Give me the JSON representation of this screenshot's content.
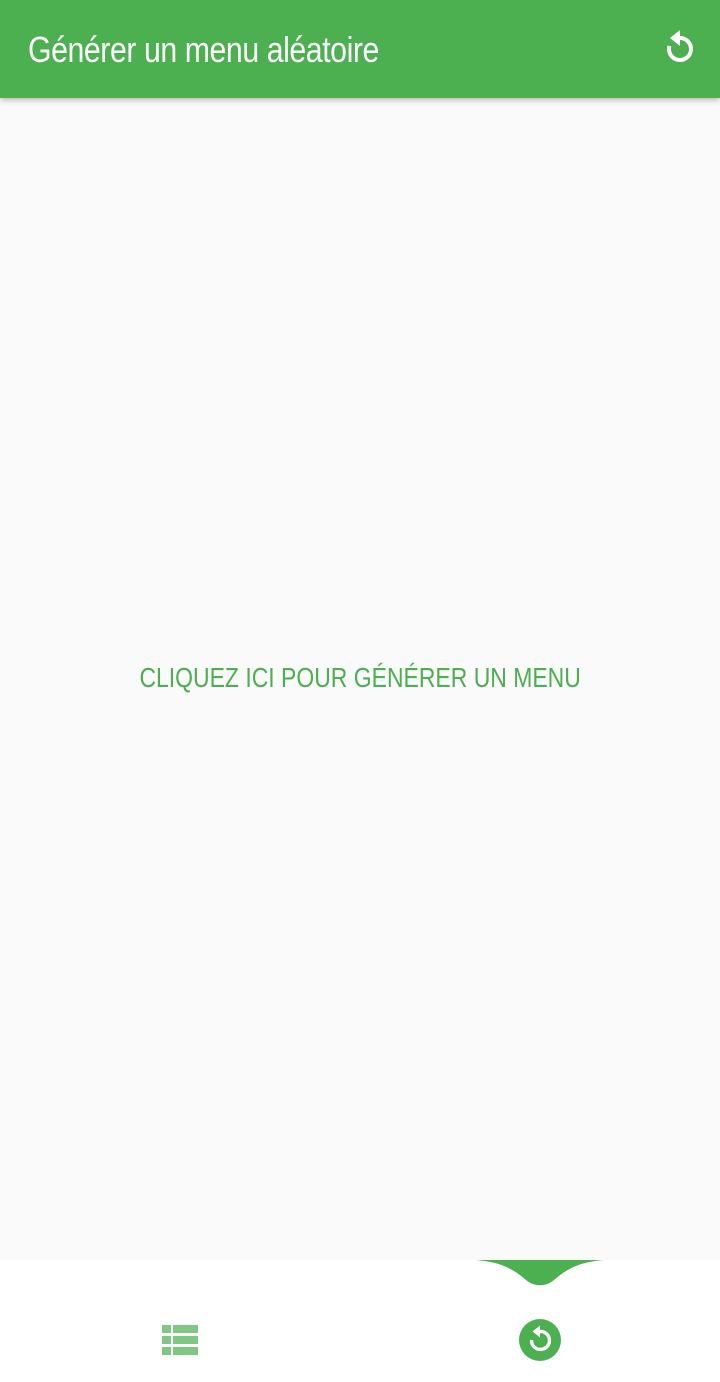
{
  "appbar": {
    "title": "Générer un menu aléatoire",
    "action_icon": "refresh-icon"
  },
  "content": {
    "generate_label": "CLIQUEZ ICI POUR GÉNÉRER UN MENU"
  },
  "bottom_nav": {
    "items": [
      {
        "icon": "list-icon",
        "active": false
      },
      {
        "icon": "refresh-circle-icon",
        "active": true
      }
    ]
  },
  "colors": {
    "primary": "#4caf50",
    "primary_light": "#81c784",
    "background": "#fafafa",
    "nav_background": "#ffffff"
  }
}
